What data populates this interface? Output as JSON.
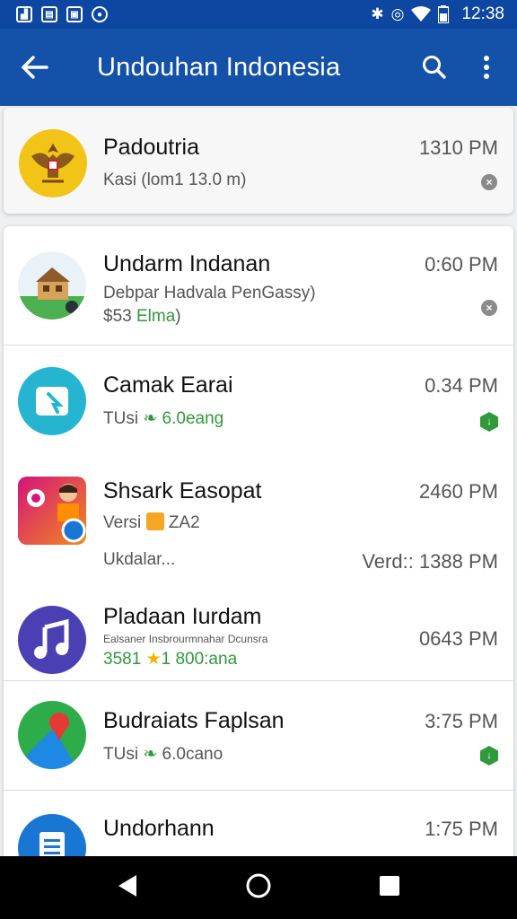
{
  "status_bar": {
    "time": "12:38",
    "left_icons": [
      "image-icon",
      "calendar-icon",
      "save-icon",
      "game-icon"
    ],
    "right_icons": [
      "bluetooth-icon",
      "alarm-icon",
      "wifi-icon",
      "battery-icon"
    ]
  },
  "app_bar": {
    "title": "Undouhan Indonesia",
    "icons": [
      "back-arrow-icon",
      "search-icon",
      "more-vert-icon"
    ]
  },
  "pinned_item": {
    "name": "Padoutria",
    "time": "1310 PM",
    "subtitle": "Kasi  (lom1 13.0 m)",
    "avatar_color": "#f2c418",
    "badge_icon": "close-icon"
  },
  "items": [
    {
      "name": "Undarm Indanan",
      "time": "0:60 PM",
      "subtitle": "Debpar Hadvala PenGassy)",
      "subtitle2_prefix": "$53 ",
      "subtitle2_green": "Elma",
      "subtitle2_suffix": ")",
      "badge_icon": "close-icon"
    },
    {
      "name": "Camak Earai",
      "time": "0.34 PM",
      "subtitle_prefix": "TUsi",
      "subtitle_green": "6.0eang",
      "badge_icon": "shield-icon",
      "avatar_color": "#26b5d1"
    },
    {
      "name": "Shsark Easopat",
      "time": "2460 PM",
      "subtitle_prefix": "Versi",
      "subtitle_suffix": "ZA2",
      "footer_left": "Ukdalar...",
      "footer_right": "Verd:: 1388 PM"
    },
    {
      "name": "Pladaan Iurdam",
      "time": "0643 PM",
      "subtitle_small": "Ealsaner Insbrourmnahar Dcunsra",
      "subtitle2_green_a": "3581",
      "subtitle2_green_b": "1 800:ana",
      "avatar_color": "#4a3fb3"
    },
    {
      "name": "Budraiats Faplsan",
      "time": "3:75 PM",
      "subtitle_prefix": "TUsi",
      "subtitle_green": "6.0cano",
      "badge_icon": "shield-icon",
      "avatar_color": "#2eac4a"
    },
    {
      "name": "Undorhann",
      "time": "1:75 PM",
      "avatar_color": "#1976d2"
    }
  ],
  "nav_bar": {
    "icons": [
      "back-triangle-icon",
      "home-circle-icon",
      "recents-square-icon"
    ]
  }
}
